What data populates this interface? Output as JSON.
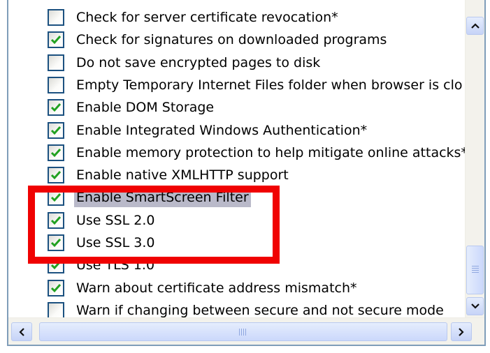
{
  "settings": {
    "items": [
      {
        "label": "Check for server certificate revocation*",
        "checked": false,
        "selected": false
      },
      {
        "label": "Check for signatures on downloaded programs",
        "checked": true,
        "selected": false
      },
      {
        "label": "Do not save encrypted pages to disk",
        "checked": false,
        "selected": false
      },
      {
        "label": "Empty Temporary Internet Files folder when browser is clo",
        "checked": false,
        "selected": false
      },
      {
        "label": "Enable DOM Storage",
        "checked": true,
        "selected": false
      },
      {
        "label": "Enable Integrated Windows Authentication*",
        "checked": true,
        "selected": false
      },
      {
        "label": "Enable memory protection to help mitigate online attacks*",
        "checked": true,
        "selected": false
      },
      {
        "label": "Enable native XMLHTTP support",
        "checked": true,
        "selected": false
      },
      {
        "label": "Enable SmartScreen Filter",
        "checked": true,
        "selected": true
      },
      {
        "label": "Use SSL 2.0",
        "checked": true,
        "selected": false
      },
      {
        "label": "Use SSL 3.0",
        "checked": true,
        "selected": false
      },
      {
        "label": "Use TLS 1.0",
        "checked": true,
        "selected": false
      },
      {
        "label": "Warn about certificate address mismatch*",
        "checked": true,
        "selected": false
      },
      {
        "label": "Warn if changing between secure and not secure mode",
        "checked": false,
        "selected": false
      }
    ]
  },
  "icons": {
    "checkmark": "checkmark-icon",
    "scroll_up": "chevron-up-icon",
    "scroll_down": "chevron-down-icon",
    "scroll_left": "chevron-left-icon",
    "scroll_right": "chevron-right-icon"
  },
  "colors": {
    "checkmark": "#21a121",
    "selection": "#b9b9c9",
    "highlight_box": "#f00202",
    "checkbox_border": "#1c5180"
  }
}
